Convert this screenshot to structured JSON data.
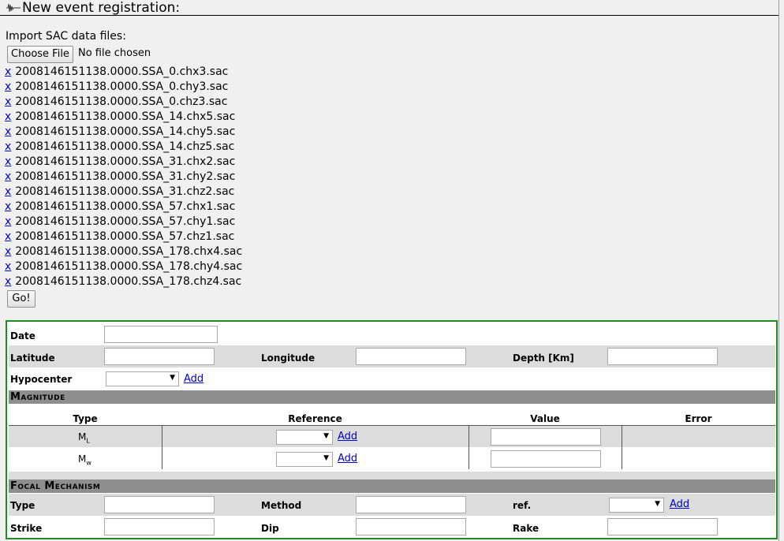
{
  "title": "New event registration:",
  "import": {
    "label": "Import SAC data files:",
    "choose_button": "Choose File",
    "no_file_text": "No file chosen",
    "remove_symbol": "x",
    "files": [
      "2008146151138.0000.SSA_0.chx3.sac",
      "2008146151138.0000.SSA_0.chy3.sac",
      "2008146151138.0000.SSA_0.chz3.sac",
      "2008146151138.0000.SSA_14.chx5.sac",
      "2008146151138.0000.SSA_14.chy5.sac",
      "2008146151138.0000.SSA_14.chz5.sac",
      "2008146151138.0000.SSA_31.chx2.sac",
      "2008146151138.0000.SSA_31.chy2.sac",
      "2008146151138.0000.SSA_31.chz2.sac",
      "2008146151138.0000.SSA_57.chx1.sac",
      "2008146151138.0000.SSA_57.chy1.sac",
      "2008146151138.0000.SSA_57.chz1.sac",
      "2008146151138.0000.SSA_178.chx4.sac",
      "2008146151138.0000.SSA_178.chy4.sac",
      "2008146151138.0000.SSA_178.chz4.sac"
    ],
    "go_button": "Go!"
  },
  "form": {
    "date_label": "Date",
    "latitude_label": "Latitude",
    "longitude_label": "Longitude",
    "depth_label": "Depth [Km]",
    "hypocenter_label": "Hypocenter",
    "add_link": "Add",
    "magnitude_section": "Magnitude",
    "mag_headers": {
      "type": "Type",
      "reference": "Reference",
      "value": "Value",
      "error": "Error"
    },
    "mag_rows": [
      {
        "sym": "M",
        "sub": "L"
      },
      {
        "sym": "M",
        "sub": "w"
      }
    ],
    "focal_section": "Focal Mechanism",
    "focal_type_label": "Type",
    "method_label": "Method",
    "ref_label": "ref.",
    "strike_label": "Strike",
    "dip_label": "Dip",
    "rake_label": "Rake",
    "dropdown_arrow": "▼"
  },
  "colors": {
    "panel_border": "#1e8c1e",
    "link": "#0000cc",
    "section_bg": "#8e8e8e",
    "row_gray": "#dcdcdc"
  }
}
